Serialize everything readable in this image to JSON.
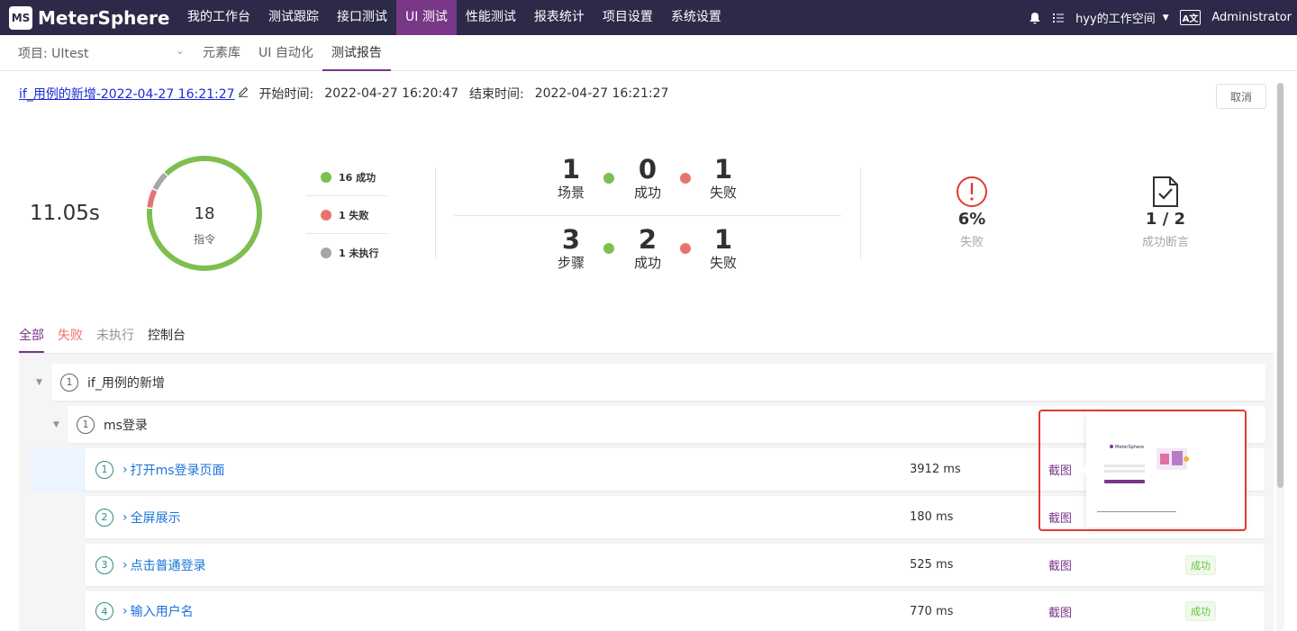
{
  "app": {
    "logo_mark": "MS",
    "name": "MeterSphere"
  },
  "nav": {
    "items": [
      {
        "label": "我的工作台"
      },
      {
        "label": "测试跟踪"
      },
      {
        "label": "接口测试"
      },
      {
        "label": "UI 测试",
        "active": true
      },
      {
        "label": "性能测试"
      },
      {
        "label": "报表统计"
      },
      {
        "label": "项目设置"
      },
      {
        "label": "系统设置"
      }
    ],
    "workspace": "hyy的工作空间",
    "lang_icon": "A文",
    "user": "Administrator"
  },
  "subbar": {
    "project": "项目: UItest",
    "tabs": [
      {
        "label": "元素库"
      },
      {
        "label": "UI 自动化"
      },
      {
        "label": "测试报告",
        "active": true
      }
    ]
  },
  "report": {
    "title": "if_用例的新增-2022-04-27 16:21:27",
    "start_label": "开始时间:",
    "start_value": "2022-04-27 16:20:47",
    "end_label": "结束时间:",
    "end_value": "2022-04-27 16:21:27",
    "cancel_label": "取消"
  },
  "summary": {
    "duration": "11.05s",
    "total": "18",
    "total_label": "指令",
    "legend": [
      {
        "label": "16 成功",
        "color": "#7ebf50"
      },
      {
        "label": "1 失败",
        "color": "#e57470"
      },
      {
        "label": "1 未执行",
        "color": "#a6a6a6"
      }
    ],
    "scenario": {
      "count": "1",
      "label": "场景",
      "success": "0",
      "success_label": "成功",
      "fail": "1",
      "fail_label": "失败"
    },
    "steps": {
      "count": "3",
      "label": "步骤",
      "success": "2",
      "success_label": "成功",
      "fail": "1",
      "fail_label": "失败"
    },
    "fail_rate": "6%",
    "fail_rate_label": "失败",
    "assertions": "1 / 2",
    "assertions_label": "成功断言"
  },
  "chart_data": {
    "type": "pie",
    "categories": [
      "成功",
      "失败",
      "未执行"
    ],
    "values": [
      16,
      1,
      1
    ],
    "total": 18
  },
  "filters": [
    {
      "label": "全部"
    },
    {
      "label": "失败"
    },
    {
      "label": "未执行"
    },
    {
      "label": "控制台"
    }
  ],
  "tree": {
    "root": {
      "index": "1",
      "name": "if_用例的新增"
    },
    "child": {
      "index": "1",
      "name": "ms登录"
    },
    "steps": [
      {
        "index": "1",
        "name": "打开ms登录页面",
        "time": "3912 ms",
        "shot": "截图"
      },
      {
        "index": "2",
        "name": "全屏展示",
        "time": "180 ms",
        "shot": "截图"
      },
      {
        "index": "3",
        "name": "点击普通登录",
        "time": "525 ms",
        "shot": "截图",
        "status": "成功"
      },
      {
        "index": "4",
        "name": "输入用户名",
        "time": "770 ms",
        "shot": "截图",
        "status": "成功"
      }
    ]
  },
  "popover": {
    "thumb_brand": "MeterSphere"
  }
}
